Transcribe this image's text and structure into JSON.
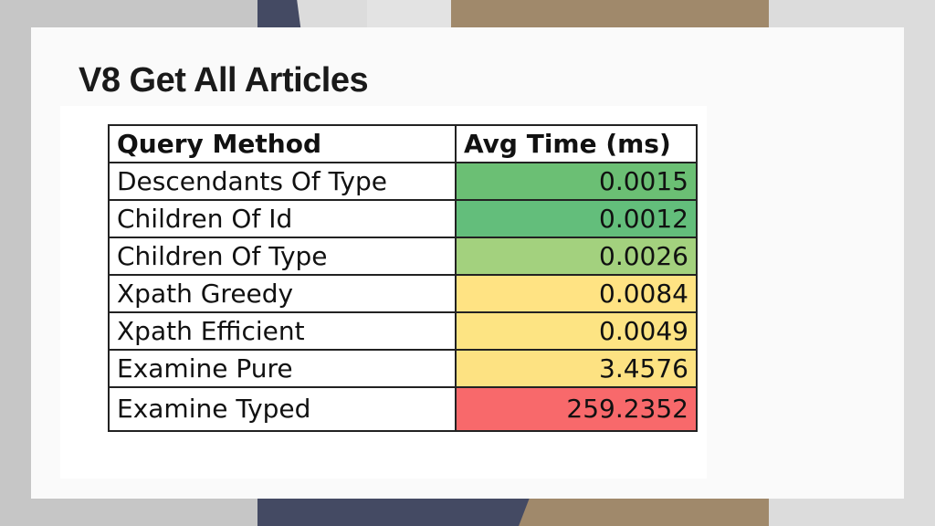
{
  "slide": {
    "title": "V8 Get All Articles"
  },
  "table": {
    "headers": [
      "Query Method",
      "Avg Time (ms)"
    ],
    "rows": [
      {
        "method": "Descendants Of Type",
        "avg_time": "0.0015",
        "color": "#6bbf74"
      },
      {
        "method": "Children Of Id",
        "avg_time": "0.0012",
        "color": "#63be7b"
      },
      {
        "method": "Children Of Type",
        "avg_time": "0.0026",
        "color": "#a3d17e"
      },
      {
        "method": "Xpath Greedy",
        "avg_time": "0.0084",
        "color": "#ffe383"
      },
      {
        "method": "Xpath Efficient",
        "avg_time": "0.0049",
        "color": "#fde483"
      },
      {
        "method": "Examine Pure",
        "avg_time": "3.4576",
        "color": "#fde282"
      },
      {
        "method": "Examine Typed",
        "avg_time": "259.2352",
        "color": "#f8696b"
      }
    ]
  }
}
